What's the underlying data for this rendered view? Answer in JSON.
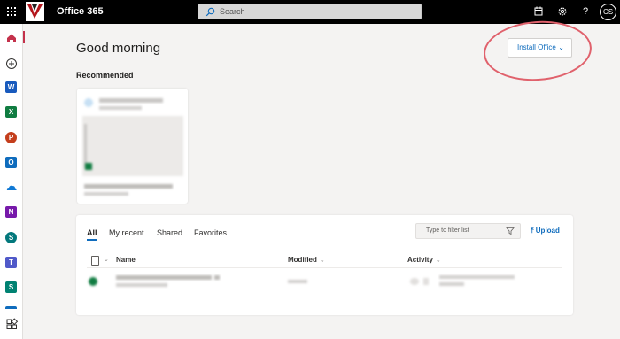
{
  "header": {
    "app_title": "Office 365",
    "search_placeholder": "Search",
    "avatar_initials": "CS",
    "help_label": "?"
  },
  "rail": {
    "items": [
      "home-icon",
      "create-icon",
      "word-icon",
      "excel-icon",
      "powerpoint-icon",
      "outlook-icon",
      "onedrive-icon",
      "onenote-icon",
      "sharepoint-icon",
      "teams-icon",
      "sway-icon",
      "apps-icon"
    ],
    "app_letters": [
      "W",
      "X",
      "P",
      "O",
      "N",
      "S",
      "T",
      "S"
    ]
  },
  "main": {
    "greeting": "Good morning",
    "install_button": "Install Office",
    "recommended_label": "Recommended"
  },
  "files": {
    "tabs": [
      {
        "label": "All",
        "active": true
      },
      {
        "label": "My recent",
        "active": false
      },
      {
        "label": "Shared",
        "active": false
      },
      {
        "label": "Favorites",
        "active": false
      }
    ],
    "filter_placeholder": "Type to filter list",
    "upload_label": "Upload",
    "columns": [
      "Name",
      "Modified",
      "Activity"
    ]
  },
  "colors": {
    "accent": "#0f6cbd",
    "annotation": "#e0616c",
    "home_active": "#c4314b"
  }
}
